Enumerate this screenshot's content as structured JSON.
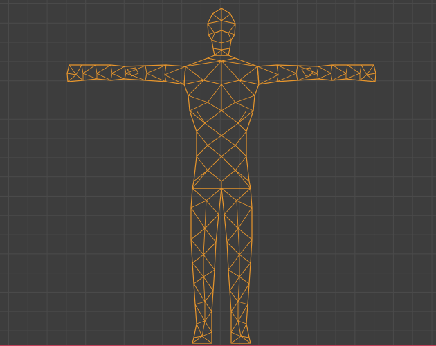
{
  "viewport": {
    "grid_visible": true,
    "background_color": "#3d3d3d",
    "grid_color": "#4a4a4a"
  },
  "object": {
    "selected": true,
    "display_mode": "wireframe",
    "wire_color": "#e8962c"
  },
  "axis": {
    "x_axis_color": "#c2405a"
  }
}
